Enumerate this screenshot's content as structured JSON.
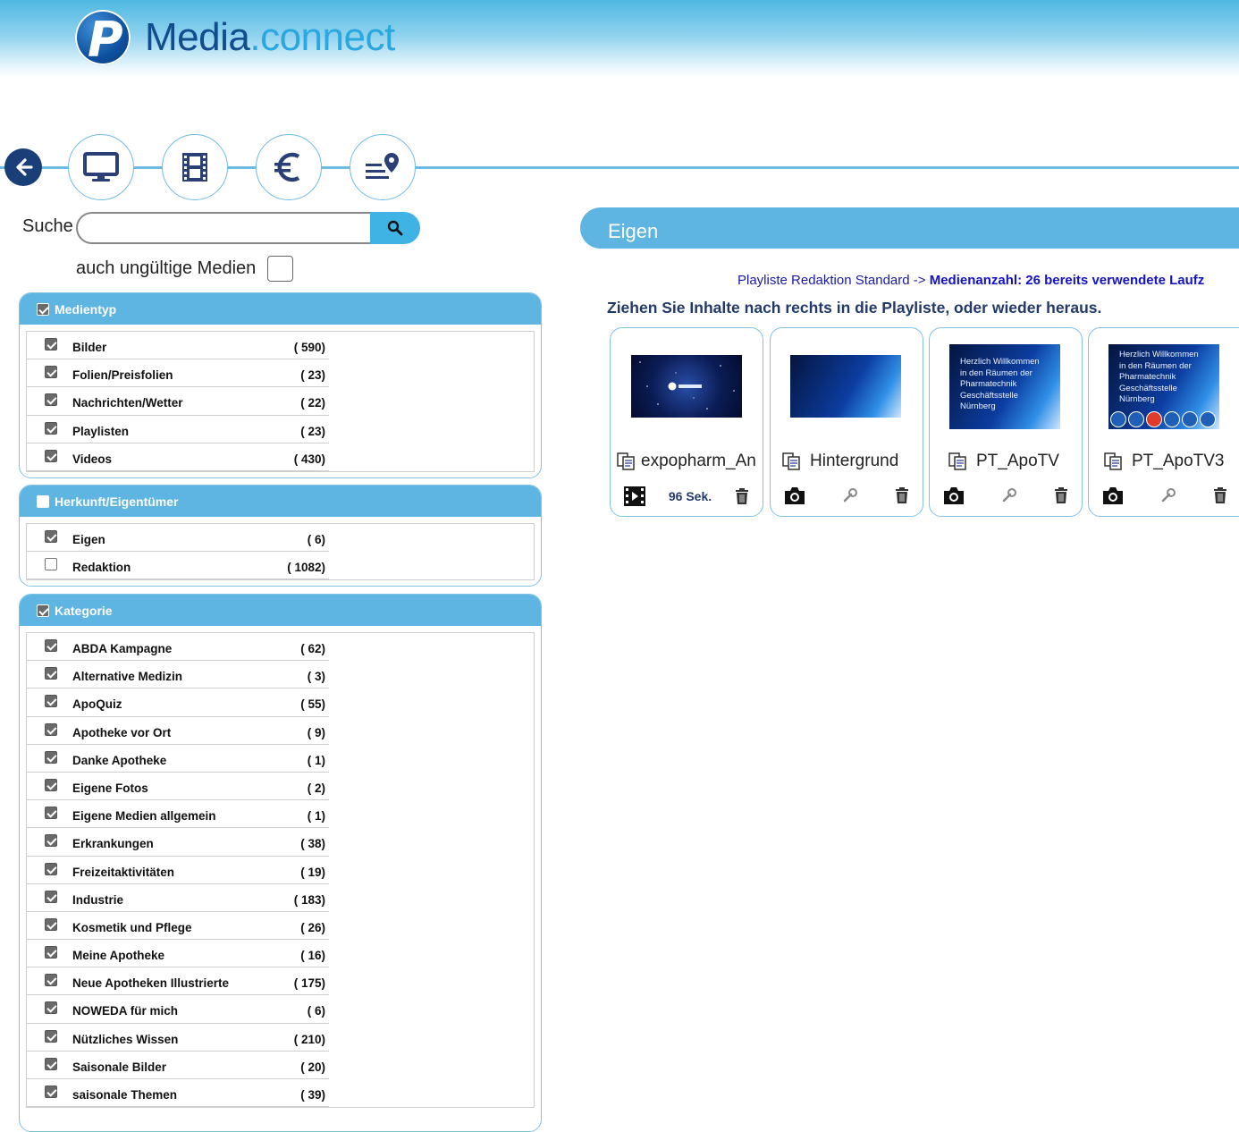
{
  "brand": {
    "part1": "Media",
    "dot": ".",
    "part2": "connect"
  },
  "nav": {
    "icons": [
      "back-arrow-icon",
      "monitor-icon",
      "film-icon",
      "euro-icon",
      "playlist-location-icon"
    ]
  },
  "search": {
    "label": "Suche",
    "value": "",
    "placeholder": "",
    "invalid_label": "auch ungültige Medien"
  },
  "filters": [
    {
      "title": "Medientyp",
      "checked": true,
      "items": [
        {
          "label": "Bilder",
          "count": "( 590)",
          "checked": true
        },
        {
          "label": "Folien/Preisfolien",
          "count": "( 23)",
          "checked": true
        },
        {
          "label": "Nachrichten/Wetter",
          "count": "( 22)",
          "checked": true
        },
        {
          "label": "Playlisten",
          "count": "( 23)",
          "checked": true
        },
        {
          "label": "Videos",
          "count": "( 430)",
          "checked": true
        }
      ]
    },
    {
      "title": "Herkunft/Eigentümer",
      "checked": false,
      "items": [
        {
          "label": "Eigen",
          "count": "( 6)",
          "checked": true
        },
        {
          "label": "Redaktion",
          "count": "( 1082)",
          "checked": false
        }
      ]
    },
    {
      "title": "Kategorie",
      "checked": true,
      "items": [
        {
          "label": "ABDA Kampagne",
          "count": "( 62)",
          "checked": true
        },
        {
          "label": "Alternative Medizin",
          "count": "( 3)",
          "checked": true
        },
        {
          "label": "ApoQuiz",
          "count": "( 55)",
          "checked": true
        },
        {
          "label": "Apotheke vor Ort",
          "count": "( 9)",
          "checked": true
        },
        {
          "label": "Danke Apotheke",
          "count": "( 1)",
          "checked": true
        },
        {
          "label": "Eigene Fotos",
          "count": "( 2)",
          "checked": true
        },
        {
          "label": "Eigene Medien allgemein",
          "count": "( 1)",
          "checked": true
        },
        {
          "label": "Erkrankungen",
          "count": "( 38)",
          "checked": true
        },
        {
          "label": "Freizeitaktivitäten",
          "count": "( 19)",
          "checked": true
        },
        {
          "label": "Industrie",
          "count": "( 183)",
          "checked": true
        },
        {
          "label": "Kosmetik und Pflege",
          "count": "( 26)",
          "checked": true
        },
        {
          "label": "Meine Apotheke",
          "count": "( 16)",
          "checked": true
        },
        {
          "label": "Neue Apotheken Illustrierte",
          "count": "( 175)",
          "checked": true
        },
        {
          "label": "NOWEDA für mich",
          "count": "( 6)",
          "checked": true
        },
        {
          "label": "Nützliches Wissen",
          "count": "( 210)",
          "checked": true
        },
        {
          "label": "Saisonale Bilder",
          "count": "( 20)",
          "checked": true
        },
        {
          "label": "saisonale Themen",
          "count": "( 39)",
          "checked": true
        }
      ]
    }
  ],
  "right": {
    "section_title": "Eigen",
    "playlist_info": "Playliste Redaktion Standard ->",
    "playlist_stats": "Medienanzahl: 26 bereits verwendete Laufz",
    "drag_hint": "Ziehen Sie Inhalte nach rechts in die Playliste, oder wieder heraus."
  },
  "cards": [
    {
      "name": "expopharm_Ani",
      "type": "video",
      "duration": "96 Sek.",
      "thumb_text": ""
    },
    {
      "name": "Hintergrund",
      "type": "image",
      "duration": "",
      "thumb_text": ""
    },
    {
      "name": "PT_ApoTV",
      "type": "image",
      "duration": "",
      "thumb_text": "Herzlich Willkommen\nin den Räumen der\nPharmatechnik\nGeschäftsstelle\nNürnberg"
    },
    {
      "name": "PT_ApoTV3",
      "type": "image",
      "duration": "",
      "thumb_text": "Herzlich Willkommen\nin den Räumen der\nPharmatechnik\nGeschäftsstelle\nNürnberg"
    }
  ]
}
